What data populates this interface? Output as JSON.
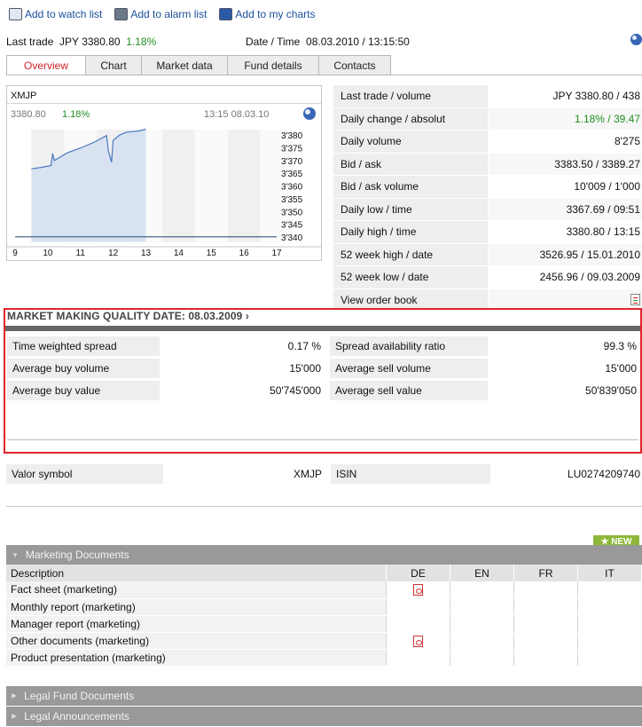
{
  "actions": {
    "watch": "Add to watch list",
    "alarm": "Add to alarm list",
    "charts": "Add to my charts"
  },
  "last_trade": {
    "label": "Last trade",
    "currency": "JPY",
    "price": "3380.80",
    "change": "1.18%"
  },
  "date_time": {
    "label": "Date / Time",
    "value": "08.03.2010 / 13:15:50"
  },
  "tabs": [
    {
      "label": "Overview",
      "active": true
    },
    {
      "label": "Chart"
    },
    {
      "label": "Market data"
    },
    {
      "label": "Fund details"
    },
    {
      "label": "Contacts"
    }
  ],
  "chart_box": {
    "symbol": "XMJP",
    "price": "3380.80",
    "change": "1.18%",
    "time_date": "13:15  08.03.10"
  },
  "chart_data": {
    "type": "area",
    "x_ticks": [
      "9",
      "10",
      "11",
      "12",
      "13",
      "14",
      "15",
      "16",
      "17"
    ],
    "y_ticks": [
      "3'380",
      "3'375",
      "3'370",
      "3'365",
      "3'360",
      "3'355",
      "3'350",
      "3'345",
      "3'340"
    ],
    "ylim": [
      3340,
      3380
    ],
    "xlim": [
      9,
      17
    ],
    "series": [
      {
        "x": [
          9.5,
          9.8,
          10.1,
          10.15,
          10.2,
          10.3,
          10.6,
          11.0,
          11.4,
          11.8,
          11.85,
          11.95,
          12.0,
          12.2,
          12.4,
          12.8,
          13.0
        ],
        "y": [
          3366.5,
          3367.0,
          3367.7,
          3372.0,
          3369.5,
          3370.2,
          3372.3,
          3374.0,
          3376.0,
          3378.5,
          3373.2,
          3368.9,
          3376.8,
          3378.7,
          3379.7,
          3380.2,
          3380.8
        ]
      }
    ],
    "reference_line": 3342
  },
  "kv": [
    {
      "k": "Last trade / volume",
      "v": "JPY  3380.80 / 438"
    },
    {
      "k": "Daily change / absolut",
      "v": "1.18% / 39.47",
      "green": true
    },
    {
      "k": "Daily volume",
      "v": "8'275"
    },
    {
      "k": "Bid / ask",
      "v": "3383.50  /  3389.27"
    },
    {
      "k": "Bid / ask volume",
      "v": "10'009  /  1'000"
    },
    {
      "k": "Daily low / time",
      "v": "3367.69  /  09:51"
    },
    {
      "k": "Daily high / time",
      "v": "3380.80  /  13:15"
    },
    {
      "k": "52 week high / date",
      "v": "3526.95  /  15.01.2010"
    },
    {
      "k": "52 week low / date",
      "v": "2456.96  /  09.03.2009"
    },
    {
      "k": "View order book",
      "v": ""
    }
  ],
  "mmq": {
    "header": "MARKET MAKING QUALITY   DATE: 08.03.2009 ›",
    "rows": [
      {
        "k1": "Time weighted spread",
        "v1": "0.17 %",
        "k2": "Spread availability ratio",
        "v2": "99.3 %"
      },
      {
        "k1": "Average buy volume",
        "v1": "15'000",
        "k2": "Average sell volume",
        "v2": "15'000"
      },
      {
        "k1": "Average buy value",
        "v1": "50'745'000",
        "k2": "Average sell value",
        "v2": "50'839'050"
      }
    ]
  },
  "ids": {
    "valor_label": "Valor symbol",
    "valor_value": "XMJP",
    "isin_label": "ISIN",
    "isin_value": "LU0274209740"
  },
  "docs": {
    "new_badge": "★ NEW",
    "marketing_title": "Marketing Documents",
    "columns": [
      "Description",
      "DE",
      "EN",
      "FR",
      "IT"
    ],
    "rows": [
      {
        "desc": "Fact sheet (marketing)",
        "de_pdf": true
      },
      {
        "desc": "Monthly report (marketing)",
        "de_pdf": false
      },
      {
        "desc": "Manager report (marketing)",
        "de_pdf": false
      },
      {
        "desc": "Other documents (marketing)",
        "de_pdf": true
      },
      {
        "desc": "Product presentation (marketing)",
        "de_pdf": false
      }
    ],
    "legal_fund": "Legal Fund Documents",
    "legal_ann": "Legal Announcements"
  }
}
